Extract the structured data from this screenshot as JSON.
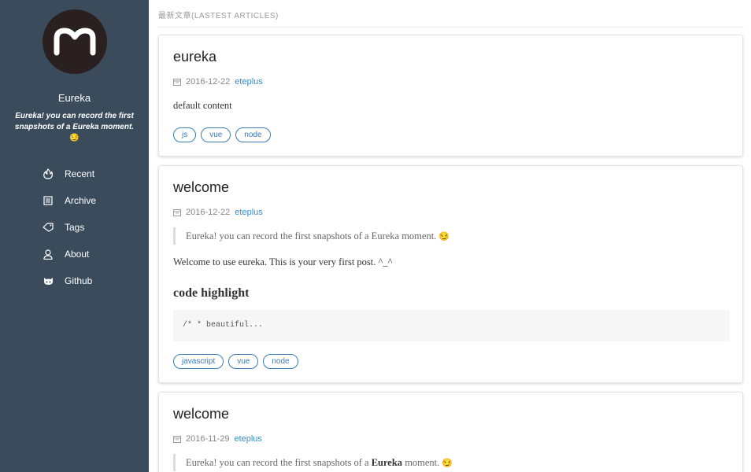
{
  "sidebar": {
    "site_name": "Eureka",
    "tagline": "Eureka! you can record the first snapshots of a Eureka moment.",
    "tagline_emoji": "😏",
    "nav": [
      {
        "label": "Recent",
        "icon": "fire-icon"
      },
      {
        "label": "Archive",
        "icon": "archive-icon"
      },
      {
        "label": "Tags",
        "icon": "tag-icon"
      },
      {
        "label": "About",
        "icon": "user-icon"
      },
      {
        "label": "Github",
        "icon": "github-icon"
      }
    ]
  },
  "main": {
    "section_title": "最新文章(LASTEST ARTICLES)",
    "posts": [
      {
        "title": "eureka",
        "date": "2016-12-22",
        "author": "eteplus",
        "content": "default content",
        "tags": [
          "js",
          "vue",
          "node"
        ]
      },
      {
        "title": "welcome",
        "date": "2016-12-22",
        "author": "eteplus",
        "quote": "Eureka! you can record the first snapshots of a Eureka moment.",
        "quote_emoji": "😏",
        "paragraph": "Welcome to use eureka. This is your very first post. ^_^",
        "heading": "code highlight",
        "code": "/* * beautiful...",
        "tags": [
          "javascript",
          "vue",
          "node"
        ]
      },
      {
        "title": "welcome",
        "date": "2016-11-29",
        "author": "eteplus",
        "quote_pre": "Eureka! you can record the first snapshots of a ",
        "quote_bold": "Eureka",
        "quote_post": " moment.",
        "quote_emoji": "😏"
      }
    ]
  },
  "colors": {
    "sidebar_bg": "#3a4b5b",
    "link": "#3a8ec7",
    "tag_border": "#3a7bb8"
  }
}
